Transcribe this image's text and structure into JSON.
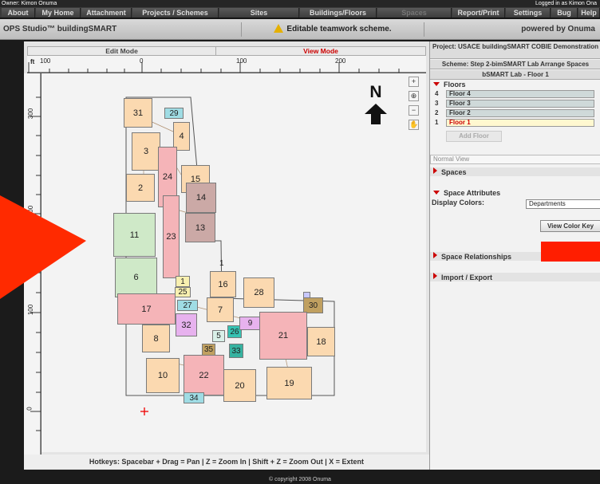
{
  "owner": {
    "left": "Owner: Kimon Onuma",
    "right": "Logged in as Kimon Ona"
  },
  "menu": [
    {
      "label": "About"
    },
    {
      "label": "My Home"
    },
    {
      "label": "Attachment"
    },
    {
      "label": "Projects / Schemes"
    },
    {
      "label": "Sites"
    },
    {
      "label": "Buildings/Floors"
    },
    {
      "label": "Spaces"
    },
    {
      "label": "Report/Print"
    },
    {
      "label": "Settings"
    },
    {
      "label": "Bug"
    },
    {
      "label": "Help"
    }
  ],
  "titlebar": {
    "app": "OPS Studio™ buildingSMART",
    "warning": "Editable teamwork scheme.",
    "powered": "powered by Onuma"
  },
  "modes": {
    "edit": "Edit Mode",
    "view": "View Mode"
  },
  "ruler": {
    "unit": "ft",
    "top": [
      "100",
      "0",
      "100",
      "200"
    ],
    "left": [
      "300",
      "200",
      "100",
      "0"
    ]
  },
  "north": "N",
  "rooms": [
    {
      "id": "31",
      "color": "#fbd9b0"
    },
    {
      "id": "29",
      "color": "#9fdce4"
    },
    {
      "id": "4",
      "color": "#fbd9b0"
    },
    {
      "id": "3",
      "color": "#fbd9b0"
    },
    {
      "id": "24",
      "color": "#f5b4b8"
    },
    {
      "id": "15",
      "color": "#fbd9b0"
    },
    {
      "id": "2",
      "color": "#fbd9b0"
    },
    {
      "id": "11",
      "color": "#cfe9c8"
    },
    {
      "id": "23",
      "color": "#f5b4b8"
    },
    {
      "id": "14",
      "color": "#cba9a6"
    },
    {
      "id": "13",
      "color": "#cba9a6"
    },
    {
      "id": "6",
      "color": "#cfe9c8"
    },
    {
      "id": "1",
      "color": "#f8f0b0"
    },
    {
      "id": "25",
      "color": "#f8f0b0"
    },
    {
      "id": "16",
      "color": "#fbd9b0"
    },
    {
      "id": "28",
      "color": "#fbd9b0"
    },
    {
      "id": "17",
      "color": "#f5b4b8"
    },
    {
      "id": "27",
      "color": "#9fdce4"
    },
    {
      "id": "7",
      "color": "#fbd9b0"
    },
    {
      "id": "30",
      "color": "#c0a060"
    },
    {
      "id": "32",
      "color": "#e7b2ee"
    },
    {
      "id": "8",
      "color": "#fbd9b0"
    },
    {
      "id": "5",
      "color": "#d9f0e8"
    },
    {
      "id": "26",
      "color": "#36c2b2"
    },
    {
      "id": "9",
      "color": "#e7b2ee"
    },
    {
      "id": "21",
      "color": "#f5b4b8"
    },
    {
      "id": "18",
      "color": "#fbd9b0"
    },
    {
      "id": "35",
      "color": "#c0a060"
    },
    {
      "id": "33",
      "color": "#36b2a0"
    },
    {
      "id": "10",
      "color": "#fbd9b0"
    },
    {
      "id": "22",
      "color": "#f5b4b8"
    },
    {
      "id": "20",
      "color": "#fbd9b0"
    },
    {
      "id": "19",
      "color": "#fbd9b0"
    },
    {
      "id": "34",
      "color": "#9fdce4"
    },
    {
      "id": "1b",
      "label": "1"
    }
  ],
  "hotkeys": "Hotkeys: Spacebar + Drag = Pan | Z = Zoom In | Shift + Z = Zoom Out | X = Extent",
  "footer": "© copyright 2008 Onuma",
  "panel": {
    "project": "Project: USACE buildingSMART COBIE Demonstration",
    "scheme": "Scheme: Step 2-bimSMART Lab Arrange Spaces",
    "building": "bSMART Lab - Floor 1",
    "floors_title": "Floors",
    "floors": [
      {
        "n": "4",
        "name": "Floor 4"
      },
      {
        "n": "3",
        "name": "Floor 3"
      },
      {
        "n": "2",
        "name": "Floor 2"
      },
      {
        "n": "1",
        "name": "Floor 1"
      }
    ],
    "add_floor": "Add Floor",
    "view_select": "Normal View",
    "spaces": "Spaces",
    "space_attributes": "Space Attributes",
    "display_colors": "Display Colors:",
    "departments": "Departments",
    "view_color_key": "View Color Key",
    "space_relationships": "Space Relationships",
    "import_export": "Import / Export"
  }
}
